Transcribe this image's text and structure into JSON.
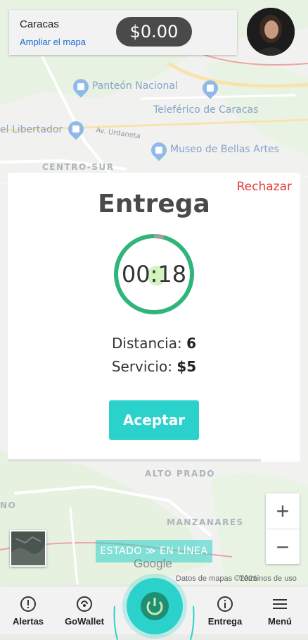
{
  "map": {
    "labels": {
      "panteon": "Panteón Nacional",
      "teleferico": "Teleférico de Caracas",
      "libertador": "el Libertador",
      "urdaneta": "Av. Urdaneta",
      "museo": "Museo de Bellas Artes",
      "centro_sur": "CENTRO-SUR",
      "alto_prado": "ALTO PRADO",
      "manzanares": "MANZANARES",
      "edge_no": "NO"
    },
    "google_logo": "Google",
    "copyright": "Datos de mapas ©2021",
    "terms": "Términos de uso"
  },
  "topbar": {
    "city": "Caracas",
    "expand_map": "Ampliar el mapa",
    "balance": "$0.00"
  },
  "modal": {
    "reject": "Rechazar",
    "title": "Entrega",
    "timer": "00:18",
    "distance_label": "Distancia:",
    "distance_value": "6",
    "service_label": "Servicio:",
    "service_value": "$5",
    "accept": "Aceptar"
  },
  "status": {
    "label": "ESTADO",
    "separator": "≫",
    "value": "EN LÍNEA"
  },
  "zoom": {
    "in": "+",
    "out": "−"
  },
  "nav": {
    "alerts": "Alertas",
    "wallet": "GoWallet",
    "delivery": "Entrega",
    "menu": "Menú"
  },
  "colors": {
    "accent": "#2bd2cc",
    "timer_ring": "#2fb57a",
    "reject": "#e2403c",
    "link": "#1e6bd6"
  }
}
